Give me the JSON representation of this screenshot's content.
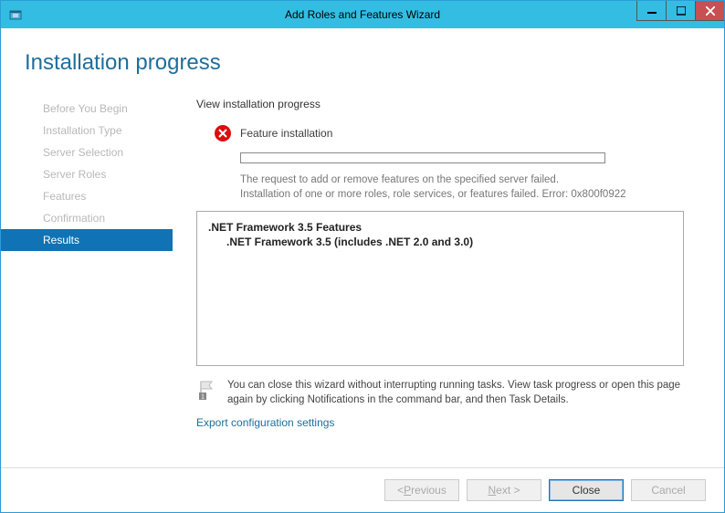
{
  "titlebar": {
    "title": "Add Roles and Features Wizard"
  },
  "header": {
    "title": "Installation progress"
  },
  "sidebar": {
    "items": [
      {
        "label": "Before You Begin",
        "selected": false
      },
      {
        "label": "Installation Type",
        "selected": false
      },
      {
        "label": "Server Selection",
        "selected": false
      },
      {
        "label": "Server Roles",
        "selected": false
      },
      {
        "label": "Features",
        "selected": false
      },
      {
        "label": "Confirmation",
        "selected": false
      },
      {
        "label": "Results",
        "selected": true
      }
    ]
  },
  "main": {
    "section_title": "View installation progress",
    "status_label": "Feature installation",
    "error_line1": "The request to add or remove features on the specified server failed.",
    "error_line2": "Installation of one or more roles, role services, or features failed. Error: 0x800f0922",
    "features": {
      "parent": ".NET Framework 3.5 Features",
      "child": ".NET Framework 3.5 (includes .NET 2.0 and 3.0)"
    },
    "hint_text": "You can close this wizard without interrupting running tasks. View task progress or open this page again by clicking Notifications in the command bar, and then Task Details.",
    "export_link": "Export configuration settings"
  },
  "footer": {
    "previous": "Previous",
    "next": "ext >",
    "close": "Close",
    "cancel": "Cancel"
  }
}
